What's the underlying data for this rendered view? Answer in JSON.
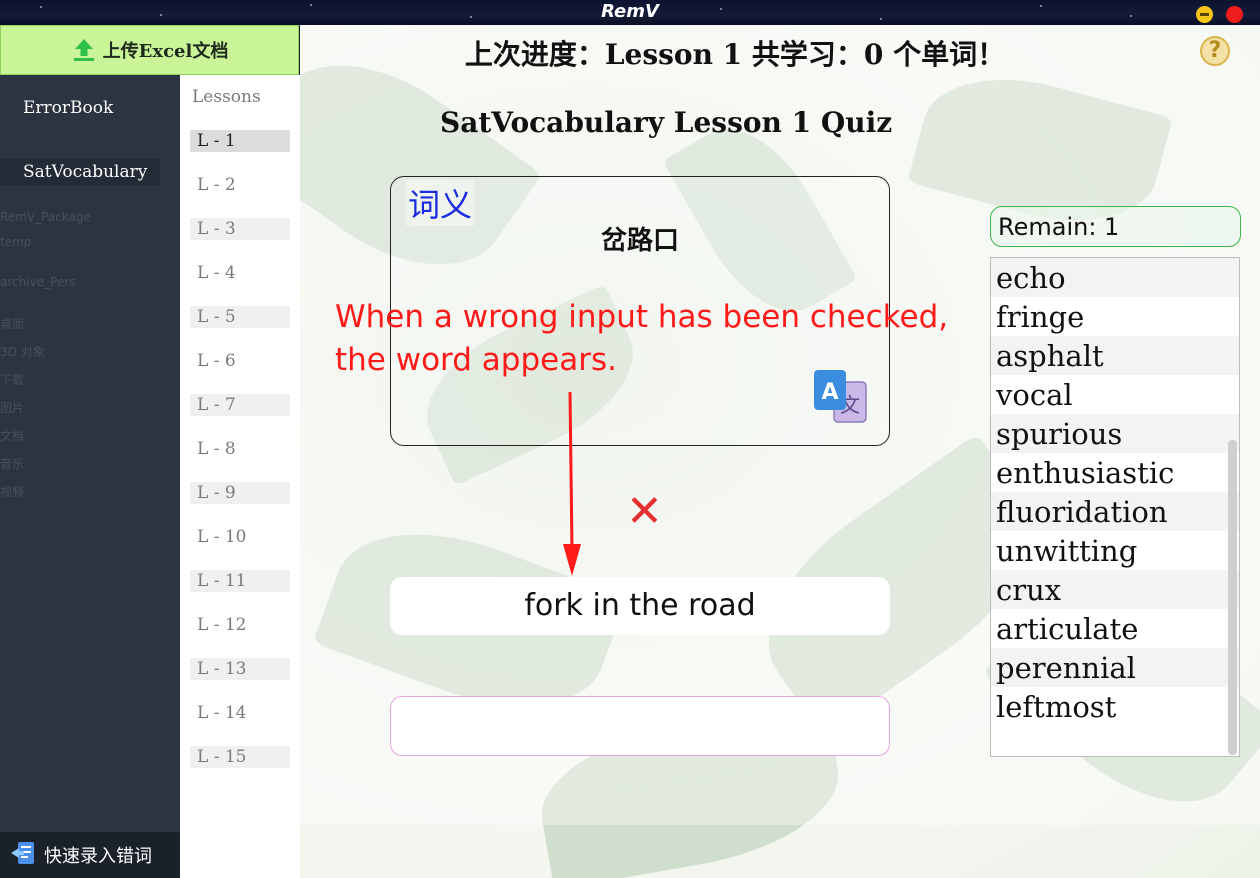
{
  "window": {
    "title": "RemV"
  },
  "sidebar": {
    "upload_label": "上传Excel文档",
    "items": [
      {
        "label": "ErrorBook"
      },
      {
        "label": "SatVocabulary"
      }
    ],
    "quick_entry_label": "快速录入错词"
  },
  "lessons": {
    "header": "Lessons",
    "items": [
      "L - 1",
      "L - 2",
      "L - 3",
      "L - 4",
      "L - 5",
      "L - 6",
      "L - 7",
      "L - 8",
      "L - 9",
      "L - 10",
      "L - 11",
      "L - 12",
      "L - 13",
      "L - 14",
      "L - 15"
    ],
    "active": "L - 1"
  },
  "main": {
    "progress_text": "上次进度：Lesson 1  共学习：0 个单词！",
    "quiz_title": "SatVocabulary Lesson 1 Quiz",
    "card": {
      "tag": "词义",
      "word": "岔路口"
    },
    "annotation": "When a wrong input has been checked, the word appears.",
    "result_symbol": "✕",
    "answer": "fork in the road",
    "input_value": ""
  },
  "remain": {
    "label": "Remain: 1"
  },
  "word_list": [
    "echo",
    "fringe",
    "asphalt",
    "vocal",
    "spurious",
    "enthusiastic",
    "fluoridation",
    "unwitting",
    "crux",
    "articulate",
    "perennial",
    "leftmost"
  ],
  "colors": {
    "upload_bg": "#c9f598",
    "annotation": "#ff1a1a",
    "card_tag": "#1a2be0",
    "remain_border": "#3cb54a",
    "wrong_mark": "#e53030"
  }
}
